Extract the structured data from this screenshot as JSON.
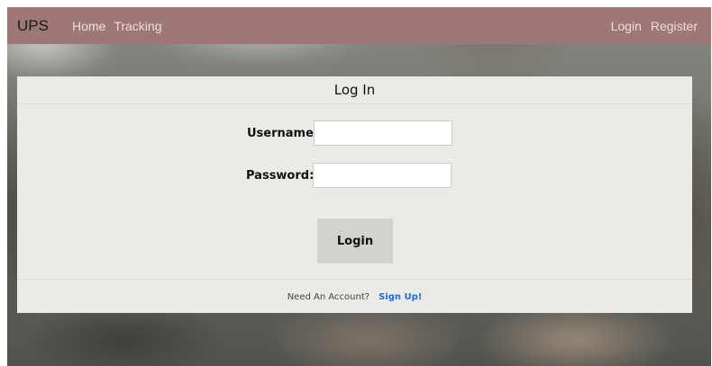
{
  "navbar": {
    "brand": "UPS",
    "left_links": [
      "Home",
      "Tracking"
    ],
    "right_links": [
      "Login",
      "Register"
    ]
  },
  "login_card": {
    "title": "Log In",
    "username_label": "Username:",
    "password_label": "Password:",
    "username_value": "",
    "password_value": "",
    "submit_label": "Login",
    "footer_text": "Need An Account?",
    "signup_link": "Sign Up!"
  },
  "colors": {
    "navbar_bg": "#a07777",
    "card_bg": "#eaeae6",
    "button_bg": "#d3d3cd",
    "link": "#1a6fe0"
  }
}
